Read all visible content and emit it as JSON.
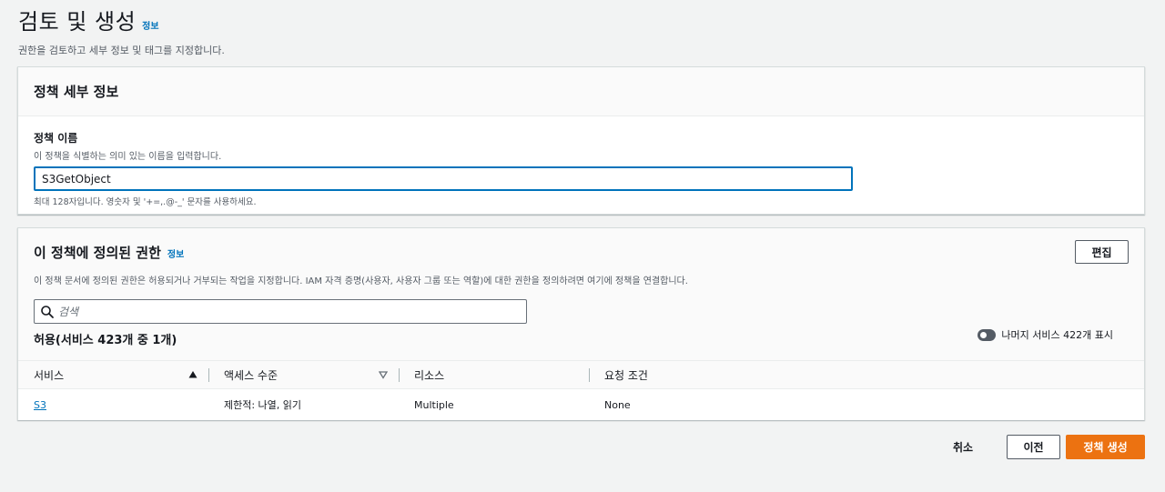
{
  "header": {
    "title": "검토 및 생성",
    "info_link": "정보",
    "description": "권한을 검토하고 세부 정보 및 태그를 지정합니다."
  },
  "policy_details": {
    "title": "정책 세부 정보",
    "name_label": "정책 이름",
    "name_description": "이 정책을 식별하는 의미 있는 이름을 입력합니다.",
    "name_value": "S3GetObject",
    "name_hint": "최대 128자입니다. 영숫자 및 '+=,.@-_' 문자를 사용하세요."
  },
  "permissions": {
    "title": "이 정책에 정의된 권한",
    "info_link": "정보",
    "edit_button": "편집",
    "description": "이 정책 문서에 정의된 권한은 허용되거나 거부되는 작업을 지정합니다. IAM 자격 증명(사용자, 사용자 그룹 또는 역할)에 대한 권한을 정의하려면 여기에 정책을 연결합니다.",
    "search_placeholder": "검색",
    "count_title": "허용(서비스 423개 중 1개)",
    "toggle_label": "나머지 서비스 422개 표시",
    "toggle_on": false,
    "columns": [
      "서비스",
      "액세스 수준",
      "리소스",
      "요청 조건"
    ],
    "rows": [
      {
        "service": "S3",
        "access_level": "제한적: 나열, 읽기",
        "resource": "Multiple",
        "condition": "None"
      }
    ]
  },
  "footer": {
    "cancel": "취소",
    "previous": "이전",
    "create": "정책 생성"
  },
  "colors": {
    "accent": "#0073bb",
    "primary_button": "#ec7211",
    "page_background": "#f2f3f3"
  }
}
